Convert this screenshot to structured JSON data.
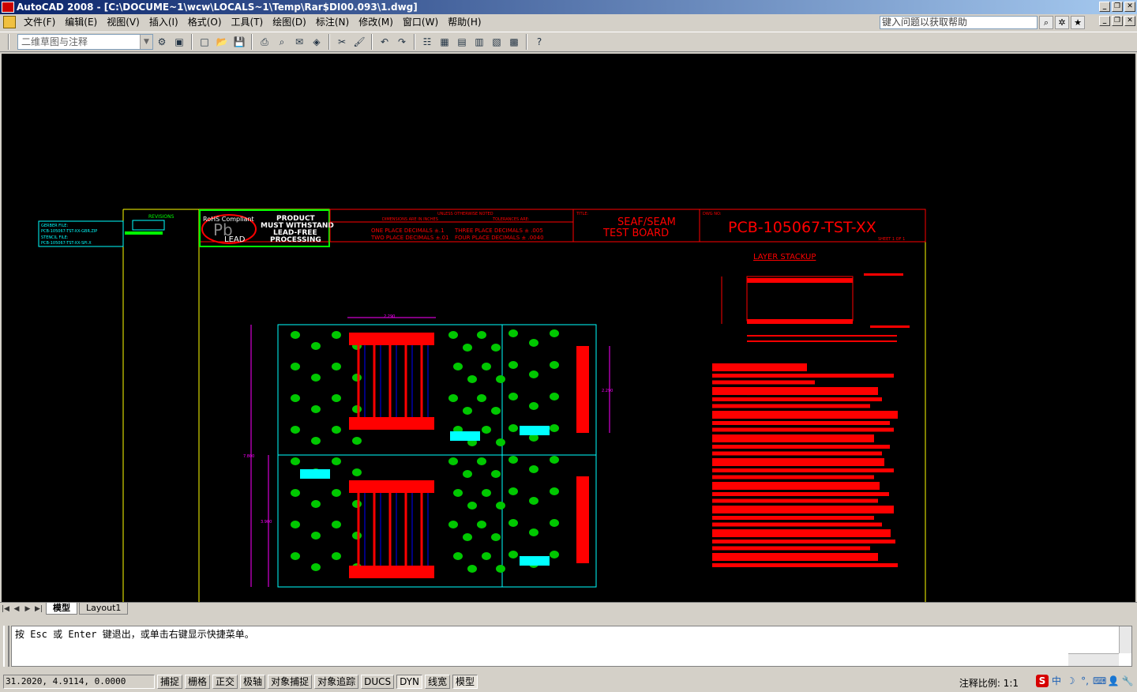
{
  "window": {
    "title": "AutoCAD 2008 - [C:\\DOCUME~1\\wcw\\LOCALS~1\\Temp\\Rar$DI00.093\\1.dwg]",
    "controls": [
      "_",
      "❐",
      "✕"
    ]
  },
  "menu": {
    "items": [
      "文件(F)",
      "编辑(E)",
      "视图(V)",
      "插入(I)",
      "格式(O)",
      "工具(T)",
      "绘图(D)",
      "标注(N)",
      "修改(M)",
      "窗口(W)",
      "帮助(H)"
    ]
  },
  "help": {
    "placeholder": "键入问题以获取帮助"
  },
  "toolbar": {
    "workspace": "二维草图与注释"
  },
  "drawing": {
    "title_block": {
      "rohs": "RoHS Compliant",
      "pb": "Pb",
      "lead": "LEAD",
      "product_lines": [
        "PRODUCT",
        "MUST WITHSTAND",
        "LEAD-FREE",
        "PROCESSING"
      ],
      "tolerance_header": "UNLESS OTHERWISE NOTED",
      "dims_label": "DIMENSIONS ARE IN INCHES",
      "tol_label": "TOLERANCES ARE:",
      "tol_one": "ONE PLACE DECIMALS ±.1",
      "tol_two": "TWO PLACE DECIMALS ±.01",
      "tol_three": "THREE PLACE DECIMALS ± .005",
      "tol_four": "FOUR PLACE DECIMALS ± .0040",
      "title_label": "TITLE:",
      "title_line1": "SEAF/SEAM",
      "title_line2": "TEST BOARD",
      "dwg_label": "DWG NO:",
      "dwg_no": "PCB-105067-TST-XX",
      "sheet": "SHEET   1 OF   1",
      "revisions": "REVISIONS",
      "gerber": "GERBER FILE:",
      "gerber_name": "PCB-105067-TST-XX-GBR.ZIP",
      "stencil": "STENCIL FILE:",
      "stencil_name": "PCB-105067-TST-XX-SPI.X"
    },
    "layer_stackup": "LAYER STACKUP",
    "dim_2290_top": "2.290",
    "dim_2290_side": "2.290",
    "dim_7800": "7.800",
    "dim_3900": "3.900"
  },
  "tabs": {
    "model": "模型",
    "layout1": "Layout1"
  },
  "command": {
    "line1": "按 Esc 或 Enter 键退出，或单击右键显示快捷菜单。",
    "line2": ""
  },
  "status": {
    "coords": "31.2020,  4.9114,  0.0000",
    "buttons": [
      "捕捉",
      "栅格",
      "正交",
      "极轴",
      "对象捕捉",
      "对象追踪",
      "DUCS",
      "DYN",
      "线宽",
      "模型"
    ],
    "scale": "注释比例:  1:1"
  },
  "colors": {
    "canvas": "#000000",
    "green": "#00ff00",
    "red": "#ff0000",
    "cyan": "#00ffff",
    "magenta": "#ff00ff",
    "yellow": "#ffff00"
  }
}
